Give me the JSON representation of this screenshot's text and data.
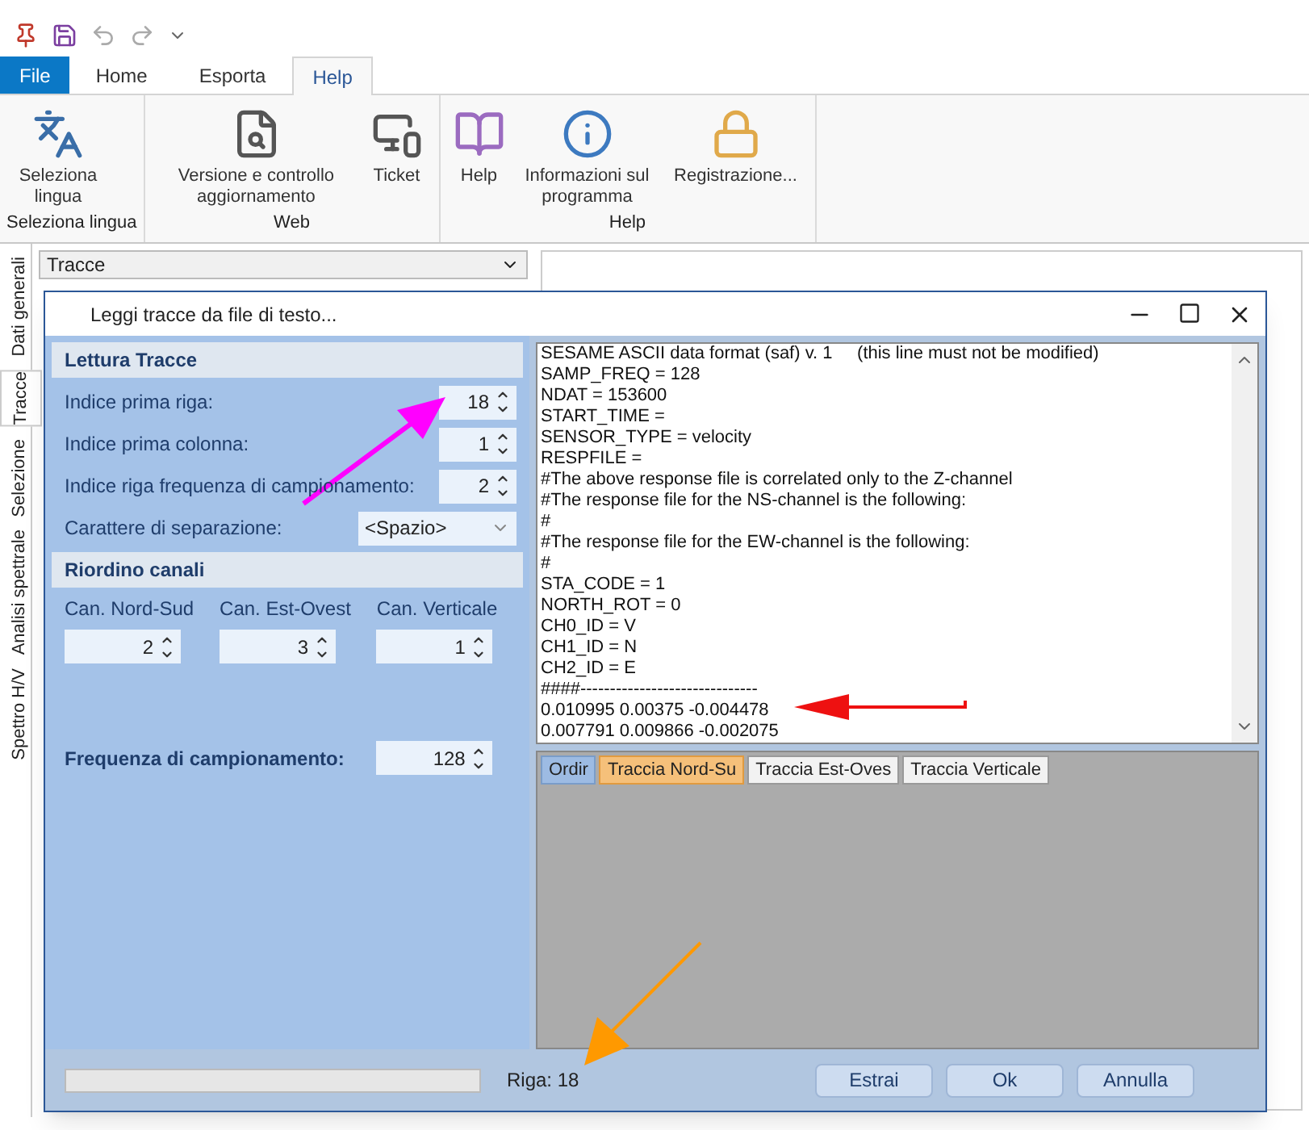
{
  "ribbon_tabs": [
    {
      "label": "File",
      "kind": "file",
      "selected": false
    },
    {
      "label": "Home",
      "kind": "tab",
      "selected": false
    },
    {
      "label": "Esporta",
      "kind": "tab",
      "selected": false
    },
    {
      "label": "Help",
      "kind": "tab",
      "selected": true
    }
  ],
  "ribbon_groups": [
    {
      "label": "Seleziona lingua",
      "buttons": [
        {
          "label": "Seleziona lingua",
          "kind": "language"
        }
      ]
    },
    {
      "label": "Web",
      "buttons": [
        {
          "label": "Versione e controllo aggiornamento",
          "kind": "update"
        },
        {
          "label": "Ticket",
          "kind": "ticket"
        }
      ]
    },
    {
      "label": "Help",
      "buttons": [
        {
          "label": "Help",
          "kind": "help"
        },
        {
          "label": "Informazioni sul programma",
          "kind": "info"
        },
        {
          "label": "Registrazione...",
          "kind": "register"
        }
      ]
    }
  ],
  "side_tabs": [
    {
      "label": "Dati generali",
      "selected": false
    },
    {
      "label": "Tracce",
      "selected": true
    },
    {
      "label": "Selezione",
      "selected": false
    },
    {
      "label": "Analisi spettrale",
      "selected": false
    },
    {
      "label": "Spettro H/V",
      "selected": false
    }
  ],
  "trace_combo": {
    "value": "Tracce"
  },
  "dialog": {
    "title": "Leggi tracce da file di testo...",
    "section_reading": {
      "title": "Lettura Tracce",
      "fields": [
        {
          "label": "Indice prima riga:",
          "kind": "spin",
          "value": "18"
        },
        {
          "label": "Indice prima colonna:",
          "kind": "spin",
          "value": "1"
        },
        {
          "label": "Indice riga frequenza di campionamento:",
          "kind": "spin",
          "value": "2"
        },
        {
          "label": "Carattere di separazione:",
          "kind": "combo",
          "value": "<Spazio>"
        }
      ]
    },
    "section_channels": {
      "title": "Riordino canali",
      "channels": [
        {
          "label": "Can. Nord-Sud",
          "value": "2"
        },
        {
          "label": "Can. Est-Ovest",
          "value": "3"
        },
        {
          "label": "Can. Verticale",
          "value": "1"
        }
      ]
    },
    "sampling": {
      "label": "Frequenza di campionamento:",
      "value": "128"
    },
    "file_lines": [
      "SESAME ASCII data format (saf) v. 1     (this line must not be modified)",
      "SAMP_FREQ = 128",
      "NDAT = 153600",
      "START_TIME =",
      "SENSOR_TYPE = velocity",
      "RESPFILE =",
      "#The above response file is correlated only to the Z-channel",
      "#The response file for the NS-channel is the following:",
      "#",
      "#The response file for the EW-channel is the following:",
      "#",
      "STA_CODE = 1",
      "NORTH_ROT = 0",
      "CH0_ID = V",
      "CH1_ID = N",
      "CH2_ID = E",
      "####------------------------------",
      "0.010995 0.00375 -0.004478",
      "0.007791 0.009866 -0.002075"
    ],
    "preview_tabs": [
      {
        "label": "Ordir",
        "selected": true,
        "hot": false
      },
      {
        "label": "Traccia Nord-Su",
        "selected": false,
        "hot": true
      },
      {
        "label": "Traccia Est-Oves",
        "selected": false,
        "hot": false
      },
      {
        "label": "Traccia Verticale",
        "selected": false,
        "hot": false
      }
    ],
    "progress": {
      "level": 0
    },
    "row_status": "Riga: 18",
    "buttons": [
      "Estrai",
      "Ok",
      "Annulla"
    ]
  }
}
